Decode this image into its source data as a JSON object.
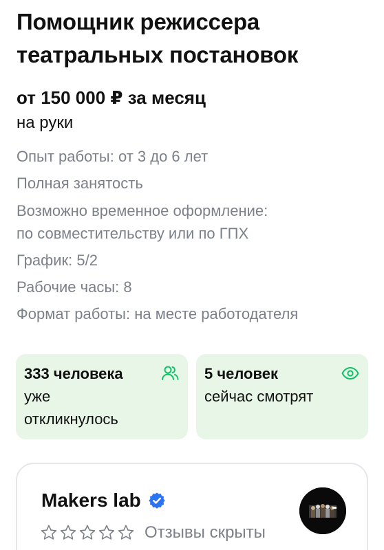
{
  "vacancy": {
    "title_line1": "Помощник режиссера",
    "title_line2": "театральных постановок",
    "salary": "от 150 000 ₽ за месяц",
    "salary_note": "на руки"
  },
  "details": {
    "experience": "Опыт работы: от 3 до 6 лет",
    "employment": "Полная занятость",
    "temporary_line1": "Возможно временное оформление:",
    "temporary_line2": "по совместительству или по ГПХ",
    "schedule": "График: 5/2",
    "hours": "Рабочие часы: 8",
    "format": "Формат работы: на месте работодателя"
  },
  "stats": {
    "responses_count": "333 человека",
    "responses_line2": "уже",
    "responses_line3": "откликнулось",
    "responses_icon": "people-icon",
    "viewers_count": "5 человек",
    "viewers_line2": "сейчас смотрят",
    "viewers_icon": "eye-icon",
    "card_bg": "#e8f6e8",
    "icon_color": "#0dc267"
  },
  "company": {
    "name": "Makers lab",
    "verified_icon": "verified-check-icon",
    "verified_color": "#2b73f5",
    "rating_stars": 0,
    "rating_max": 5,
    "reviews_text": "Отзывы скрыты"
  }
}
